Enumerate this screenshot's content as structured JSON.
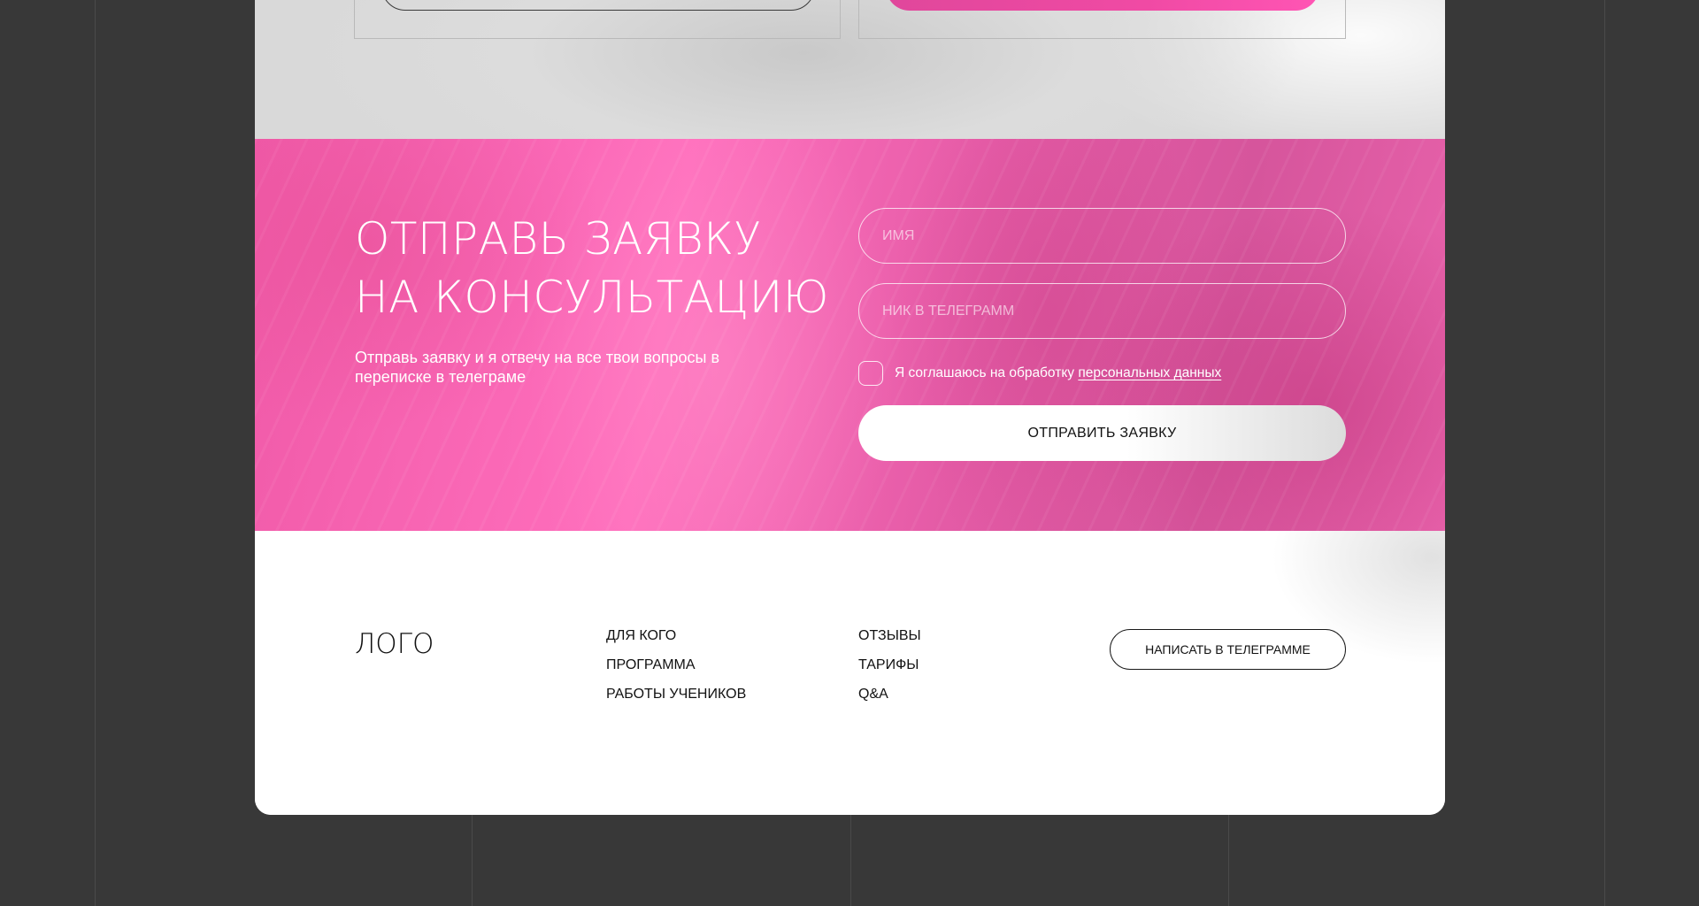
{
  "form": {
    "title_line1": "ОТПРАВЬ ЗАЯВКУ",
    "title_line2": "НА КОНСУЛЬТАЦИЮ",
    "subtitle": "Отправь заявку и я отвечу на все твои вопросы в переписке в телеграме",
    "name_placeholder": "ИМЯ",
    "name_value": "",
    "telegram_placeholder": "НИК В ТЕЛЕГРАММ",
    "telegram_value": "",
    "consent_checked": false,
    "consent_text": "Я соглашаюсь на обработку",
    "consent_link": "персональных данных",
    "submit_label": "ОТПРАВИТЬ ЗАЯВКУ"
  },
  "footer": {
    "logo": "ЛОГО",
    "nav_col1": [
      "ДЛЯ КОГО",
      "ПРОГРАММА",
      "РАБОТЫ УЧЕНИКОВ"
    ],
    "nav_col2": [
      "ОТЗЫВЫ",
      "ТАРИФЫ",
      "Q&A"
    ],
    "telegram_button": "НАПИСАТЬ В ТЕЛЕГРАММЕ"
  },
  "colors": {
    "backdrop": "#383838",
    "accent_pink": "#f04aa4",
    "text_dark": "#111111",
    "text_light": "#ffffff"
  }
}
